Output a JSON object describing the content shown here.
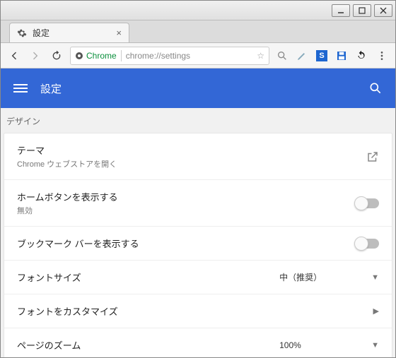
{
  "window": {
    "tab_title": "設定",
    "omnibox_secure": "Chrome",
    "omnibox_url": "chrome://settings"
  },
  "header": {
    "title": "設定"
  },
  "section": {
    "label": "デザイン"
  },
  "rows": {
    "theme": {
      "title": "テーマ",
      "subtitle": "Chrome ウェブストアを開く"
    },
    "homebtn": {
      "title": "ホームボタンを表示する",
      "subtitle": "無効"
    },
    "bookmarks": {
      "title": "ブックマーク バーを表示する"
    },
    "fontsize": {
      "title": "フォントサイズ",
      "value": "中（推奨）"
    },
    "customfont": {
      "title": "フォントをカスタマイズ"
    },
    "zoom": {
      "title": "ページのズーム",
      "value": "100%"
    }
  }
}
